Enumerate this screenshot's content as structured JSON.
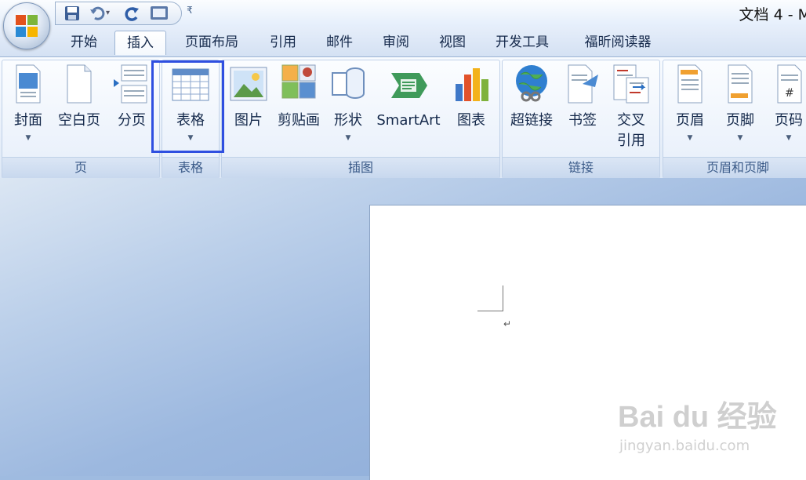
{
  "window": {
    "title": "文档 4 - M"
  },
  "tabs": [
    {
      "label": "开始"
    },
    {
      "label": "插入",
      "active": true
    },
    {
      "label": "页面布局"
    },
    {
      "label": "引用"
    },
    {
      "label": "邮件"
    },
    {
      "label": "审阅"
    },
    {
      "label": "视图"
    },
    {
      "label": "开发工具"
    },
    {
      "label": "福昕阅读器"
    }
  ],
  "ribbon": {
    "groups": {
      "pages": {
        "label": "页",
        "buttons": {
          "cover": "封面",
          "blank": "空白页",
          "break": "分页"
        }
      },
      "tables": {
        "label": "表格",
        "buttons": {
          "table": "表格"
        }
      },
      "illustrations": {
        "label": "插图",
        "buttons": {
          "picture": "图片",
          "clipart": "剪贴画",
          "shapes": "形状",
          "smartart": "SmartArt",
          "chart": "图表"
        }
      },
      "links": {
        "label": "链接",
        "buttons": {
          "hyperlink": "超链接",
          "bookmark": "书签",
          "crossref_line1": "交叉",
          "crossref_line2": "引用"
        }
      },
      "header_footer": {
        "label": "页眉和页脚",
        "buttons": {
          "header": "页眉",
          "footer": "页脚",
          "pagenum": "页码"
        }
      }
    }
  },
  "document": {
    "paragraph_mark": "↵"
  },
  "watermark": {
    "brand": "Bai du 经验",
    "url": "jingyan.baidu.com"
  },
  "colors": {
    "highlight": "#2f4fe0",
    "ribbon_text": "#15294b",
    "group_label": "#3a5a88"
  }
}
